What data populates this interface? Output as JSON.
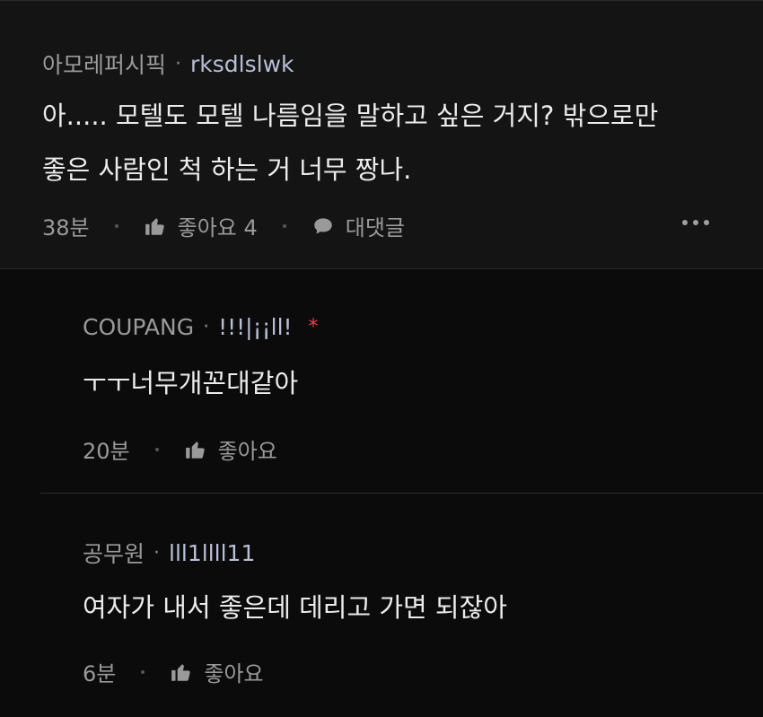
{
  "comment": {
    "author": "아모레퍼시픽",
    "separator": "·",
    "user_id": "rksdlslwk",
    "lines": [
      "아..... 모텔도 모텔 나름임을 말하고 싶은 거지? 밖으로만",
      "좋은 사람인 척 하는 거 너무 짱나."
    ],
    "time": "38분",
    "like_label": "좋아요 4",
    "reply_label": "대댓글"
  },
  "replies": [
    {
      "author": "COUPANG",
      "separator": "·",
      "user_id": "!!!|¡¡ll!",
      "star": "*",
      "text": "ㅜㅜ너무개꼰대같아",
      "time": "20분",
      "like_label": "좋아요"
    },
    {
      "author": "공무원",
      "separator": "·",
      "user_id": "lll1llll11",
      "text": "여자가 내서 좋은데 데리고 가면 되잖아",
      "time": "6분",
      "like_label": "좋아요"
    }
  ],
  "icons": {
    "like": "thumbs-up-icon",
    "reply": "speech-bubble-icon",
    "more": "more-dots-icon"
  },
  "colors": {
    "background": "#000000",
    "top_comment_bg": "#141414",
    "reply_bg": "#0b0b0b",
    "user_id": "#b9bfd6",
    "star": "#e6454f"
  }
}
